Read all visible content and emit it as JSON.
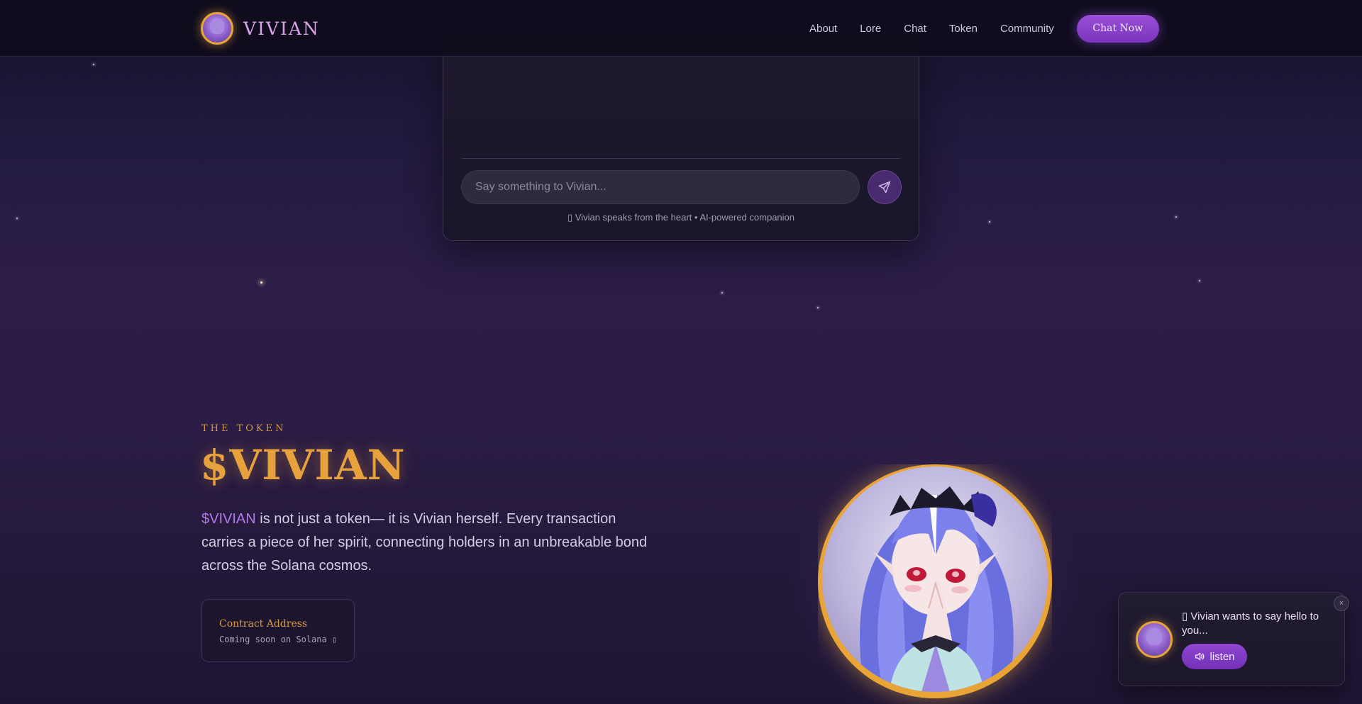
{
  "header": {
    "brand": "VIVIAN",
    "nav": [
      {
        "label": "About"
      },
      {
        "label": "Lore"
      },
      {
        "label": "Chat"
      },
      {
        "label": "Token"
      },
      {
        "label": "Community"
      }
    ],
    "cta_label": "Chat Now"
  },
  "chat": {
    "input_placeholder": "Say something to Vivian...",
    "footnote": "▯ Vivian speaks from the heart • AI-powered companion"
  },
  "token": {
    "eyebrow": "THE TOKEN",
    "title": "$VIVIAN",
    "desc_accent": "$VIVIAN",
    "desc_rest": " is not just a token— it is Vivian herself. Every transaction carries a piece of her spirit, connecting holders in an unbreakable bond across the Solana cosmos.",
    "contract_label": "Contract Address",
    "contract_value": "Coming soon on Solana ▯"
  },
  "popup": {
    "message": "▯ Vivian wants to say hello to you...",
    "listen_label": "listen",
    "close_glyph": "×"
  },
  "colors": {
    "accent_gold": "#e8a23d",
    "accent_purple": "#8e46d0",
    "background": "#211a3d"
  },
  "icons": {
    "send": "send-icon",
    "close": "close-icon",
    "speaker": "speaker-icon"
  }
}
